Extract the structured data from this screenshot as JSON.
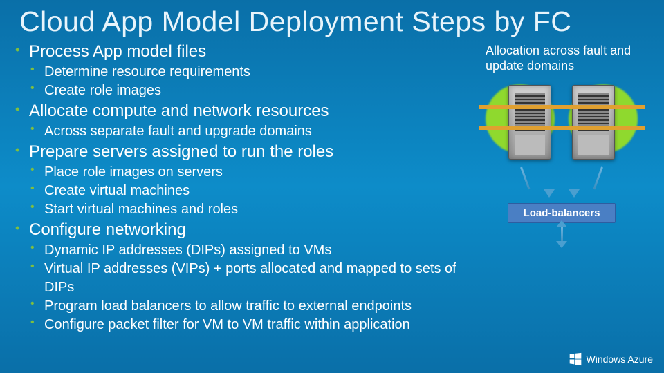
{
  "title": "Cloud App Model Deployment Steps by FC",
  "bullets": [
    {
      "h": "Process App model files",
      "sub": [
        "Determine resource requirements",
        "Create role images"
      ]
    },
    {
      "h": "Allocate compute and network resources",
      "sub": [
        "Across separate fault and upgrade domains"
      ]
    },
    {
      "h": "Prepare servers assigned to run the roles",
      "sub": [
        "Place role images on servers",
        "Create virtual machines",
        "Start virtual machines and roles"
      ]
    },
    {
      "h": "Configure networking",
      "sub": [
        "Dynamic IP addresses (DIPs) assigned to VMs",
        "Virtual IP addresses (VIPs) + ports allocated and mapped to sets of DIPs",
        "Program load balancers to allow traffic to external endpoints",
        "Configure packet filter for VM to VM traffic within application"
      ]
    }
  ],
  "diagram": {
    "label": "Allocation across fault and update domains",
    "lb_label": "Load-balancers"
  },
  "footer": {
    "brand": "Windows Azure"
  }
}
